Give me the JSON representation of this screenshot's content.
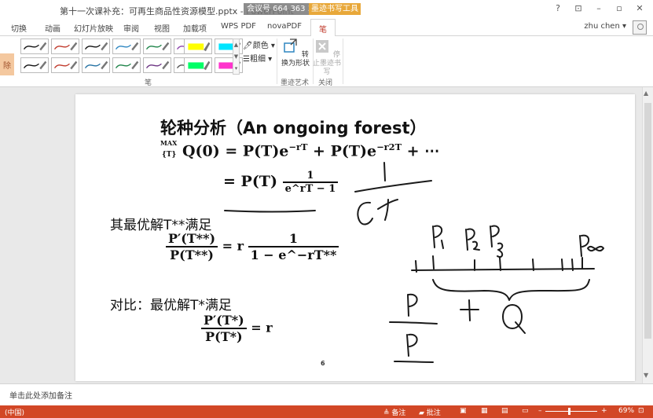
{
  "window": {
    "title": "第十一次课补充：可再生商品性资源模型.pptx - PowerPoint",
    "meeting_badge": "会议号 664 363 343",
    "context_group": "墨迹书写工具",
    "controls": [
      "?",
      "⊡",
      "–",
      "▫",
      "✕"
    ]
  },
  "tabs": {
    "items": [
      "切换",
      "动画",
      "幻灯片放映",
      "审阅",
      "视图",
      "加载项",
      "WPS PDF",
      "novaPDF"
    ],
    "active": "笔",
    "user": "zhu chen ▾"
  },
  "ribbon": {
    "left_cut_label": "除",
    "pen_colors": [
      "#111111",
      "#c0392b",
      "#111111",
      "#2e86c1",
      "#1e8449",
      "#8e44ad",
      "#111111",
      "#c0392b",
      "#2471a3",
      "#1e8449",
      "#6c3483",
      "#555555"
    ],
    "highlighters": [
      "#ffff00",
      "#00e5ff",
      "#00ff66",
      "#ff33cc"
    ],
    "color_label": "颜色 ▾",
    "weight_label": "粗细 ▾",
    "convert_label": "转换为形状",
    "stop_label": "停止墨迹书写",
    "group_pens": "笔",
    "group_ink_art": "墨迹艺术",
    "group_close": "关闭"
  },
  "slide": {
    "title": "轮种分析（An ongoing forest）",
    "eq1_max": "MAX",
    "eq1_sub": "{T}",
    "eq1_body": "Q(0) = P(T)e",
    "eq1_exp1": "−rT",
    "eq1_mid": " + P(T)e",
    "eq1_exp2": "−r2T",
    "eq1_tail": " + ⋯",
    "eq2_lhs": "= P(T)",
    "eq2_num": "1",
    "eq2_den": "e^rT − 1",
    "cond1_label": "其最优解T**满足",
    "eq3_num": "P′(T**)",
    "eq3_den": "P(T**)",
    "eq3_mid": "= r",
    "eq3_frac_num": "1",
    "eq3_frac_den": "1 − e^−rT**",
    "cond2_label": "对比：最优解T*满足",
    "eq4_num": "P′(T*)",
    "eq4_den": "P(T*)",
    "eq4_rhs": "= r",
    "page_number": "6"
  },
  "notes": {
    "placeholder": "单击此处添加备注"
  },
  "status": {
    "language": "(中国)",
    "notes_btn": "≜ 备注",
    "comments_btn": "▰ 批注",
    "zoom_minus": "–",
    "zoom_plus": "+",
    "zoom": "69%",
    "zoom_level": 0.45
  }
}
